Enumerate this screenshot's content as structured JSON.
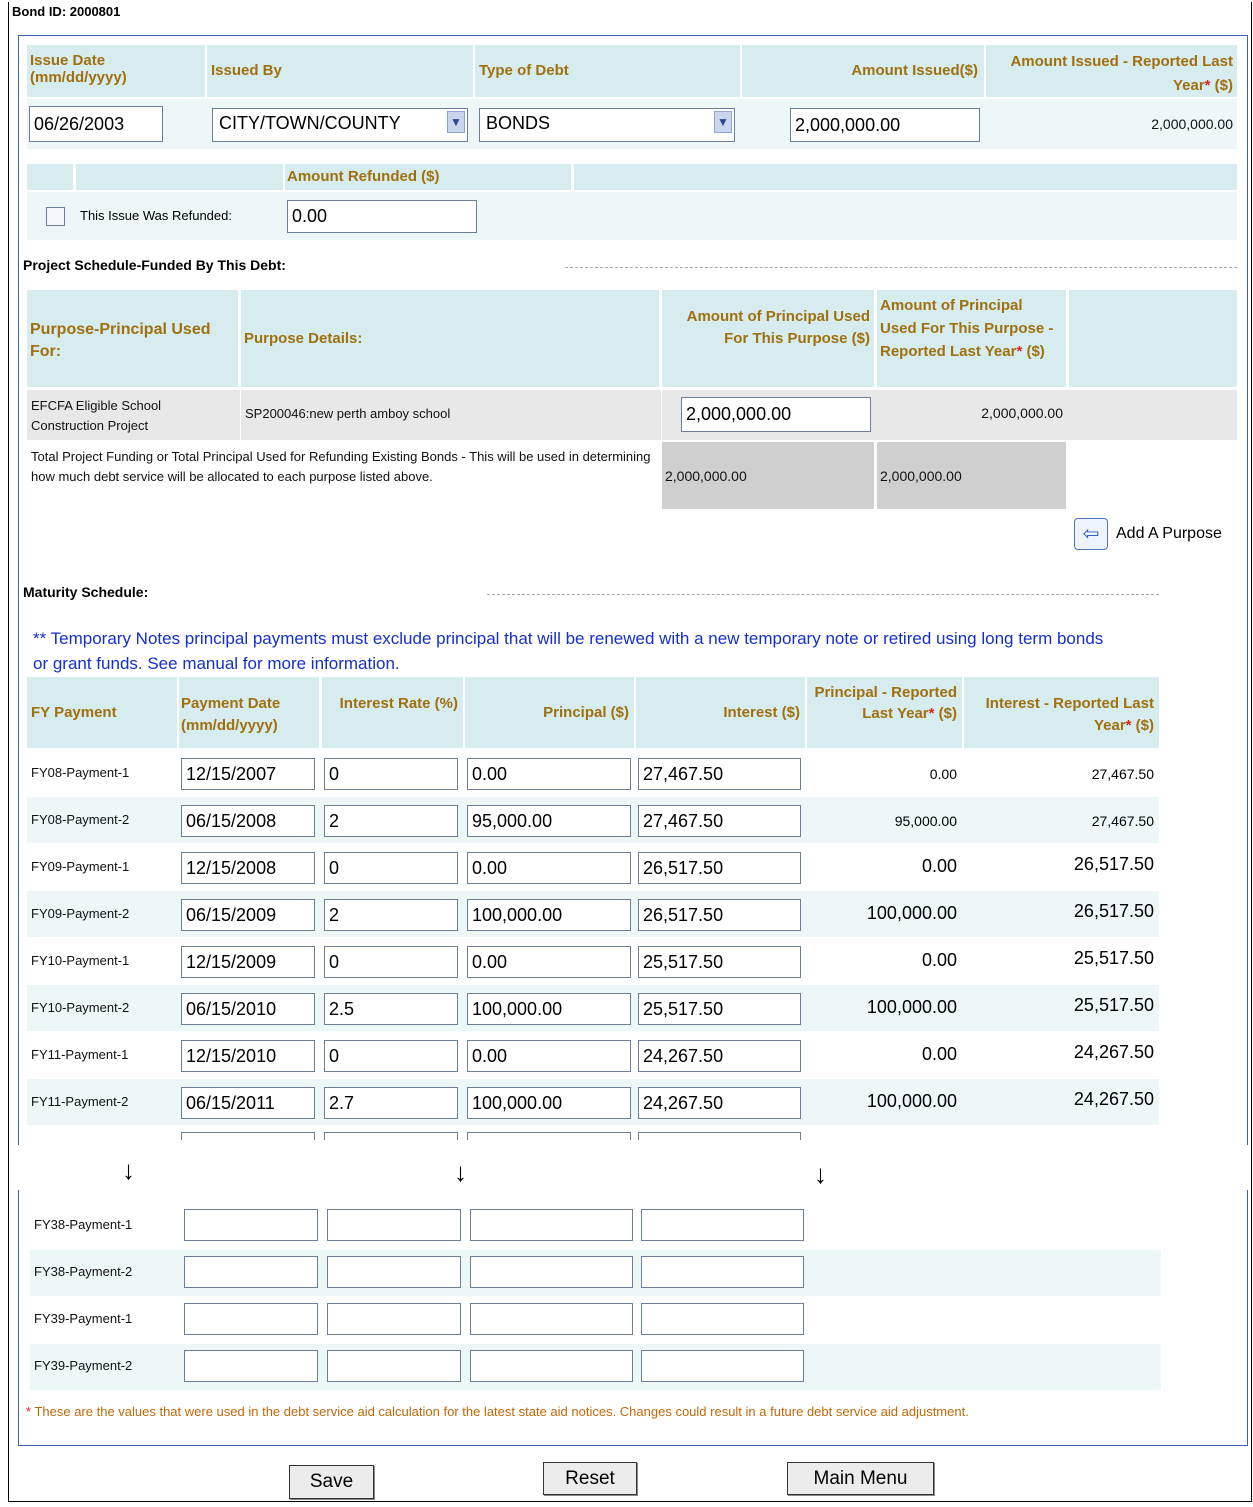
{
  "bond_id": "Bond ID: 2000801",
  "issue": {
    "headers": {
      "issue_date": "Issue Date (mm/dd/yyyy)",
      "issued_by": "Issued By",
      "type_of_debt": "Type of Debt",
      "amount_issued": "Amount Issued($)",
      "amount_reported": "Amount Issued - Reported Last Year",
      "amount_reported_suffix": " ($)"
    },
    "issue_date": "06/26/2003",
    "issued_by": "CITY/TOWN/COUNTY",
    "type_of_debt": "BONDS",
    "amount_issued": "2,000,000.00",
    "amount_reported": "2,000,000.00"
  },
  "refund": {
    "header": "Amount Refunded ($)",
    "checkbox_label": "This Issue Was Refunded:",
    "checked": false,
    "amount": "0.00"
  },
  "project": {
    "section_title": "Project Schedule-Funded By This Debt:",
    "headers": {
      "purpose": "Purpose-Principal Used For:",
      "details": "Purpose Details:",
      "amount_used": "Amount of Principal Used For This Purpose ($)",
      "amount_reported": "Amount of Principal Used For This Purpose - Reported Last Year",
      "amount_reported_suffix": " ($)"
    },
    "row": {
      "purpose": "EFCFA Eligible School Construction Project",
      "details": "SP200046:new perth amboy school",
      "amount_used": "2,000,000.00",
      "amount_reported": "2,000,000.00"
    },
    "total_label": "Total Project Funding or Total Principal Used for Refunding Existing Bonds - This will be used in determining how much debt service will be allocated to each purpose listed above.",
    "total_used": "2,000,000.00",
    "total_reported": "2,000,000.00",
    "add_purpose": "Add A Purpose"
  },
  "maturity": {
    "section_title": "Maturity Schedule:",
    "note": "** Temporary Notes principal payments must exclude principal that will be renewed with a new temporary note or retired using long term bonds or grant funds. See manual for more information.",
    "headers": {
      "fy": "FY Payment",
      "date": "Payment Date (mm/dd/yyyy)",
      "rate": "Interest Rate (%)",
      "principal": "Principal ($)",
      "interest": "Interest ($)",
      "principal_reported": "Principal - Reported Last Year",
      "principal_reported_suffix": " ($)",
      "interest_reported": "Interest - Reported Last Year",
      "interest_reported_suffix": " ($)"
    },
    "rows": [
      {
        "fy": "FY08-Payment-1",
        "date": "12/15/2007",
        "rate": "0",
        "principal": "0.00",
        "interest": "27,467.50",
        "p_rep": "0.00",
        "i_rep": "27,467.50"
      },
      {
        "fy": "FY08-Payment-2",
        "date": "06/15/2008",
        "rate": "2",
        "principal": "95,000.00",
        "interest": "27,467.50",
        "p_rep": "95,000.00",
        "i_rep": "27,467.50"
      },
      {
        "fy": "FY09-Payment-1",
        "date": "12/15/2008",
        "rate": "0",
        "principal": "0.00",
        "interest": "26,517.50",
        "p_rep": "0.00",
        "i_rep": "26,517.50"
      },
      {
        "fy": "FY09-Payment-2",
        "date": "06/15/2009",
        "rate": "2",
        "principal": "100,000.00",
        "interest": "26,517.50",
        "p_rep": "100,000.00",
        "i_rep": "26,517.50"
      },
      {
        "fy": "FY10-Payment-1",
        "date": "12/15/2009",
        "rate": "0",
        "principal": "0.00",
        "interest": "25,517.50",
        "p_rep": "0.00",
        "i_rep": "25,517.50"
      },
      {
        "fy": "FY10-Payment-2",
        "date": "06/15/2010",
        "rate": "2.5",
        "principal": "100,000.00",
        "interest": "25,517.50",
        "p_rep": "100,000.00",
        "i_rep": "25,517.50"
      },
      {
        "fy": "FY11-Payment-1",
        "date": "12/15/2010",
        "rate": "0",
        "principal": "0.00",
        "interest": "24,267.50",
        "p_rep": "0.00",
        "i_rep": "24,267.50"
      },
      {
        "fy": "FY11-Payment-2",
        "date": "06/15/2011",
        "rate": "2.7",
        "principal": "100,000.00",
        "interest": "24,267.50",
        "p_rep": "100,000.00",
        "i_rep": "24,267.50"
      }
    ],
    "late_rows": [
      {
        "fy": "FY38-Payment-1"
      },
      {
        "fy": "FY38-Payment-2"
      },
      {
        "fy": "FY39-Payment-1"
      },
      {
        "fy": "FY39-Payment-2"
      }
    ]
  },
  "footnote": "These are the values that were used in the debt service aid calculation for the latest state aid notices. Changes could result in a future debt service aid adjustment.",
  "buttons": {
    "save": "Save",
    "reset": "Reset",
    "main_menu": "Main Menu"
  },
  "colors": {
    "header_bg": "#d6ecef",
    "header_text": "#a0700e",
    "note_blue": "#1530c8",
    "footnote_orange": "#c0680a",
    "border_blue": "#3a63a8"
  }
}
